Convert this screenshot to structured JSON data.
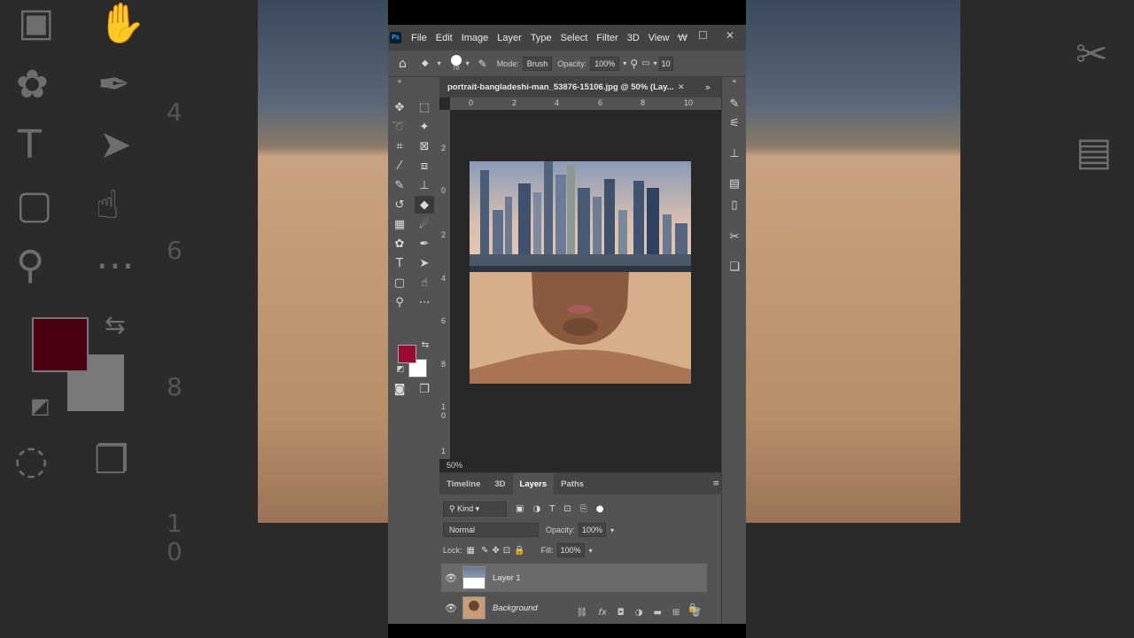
{
  "menu": {
    "items": [
      "File",
      "Edit",
      "Image",
      "Layer",
      "Type",
      "Select",
      "Filter",
      "3D",
      "View",
      "W"
    ]
  },
  "options": {
    "brush_size": "70",
    "mode_label": "Mode:",
    "mode_value": "Brush",
    "opacity_label": "Opacity:",
    "opacity_value": "100%",
    "extra_value": "10"
  },
  "document": {
    "tab_title": "portrait-bangladeshi-man_53876-15106.jpg @ 50% (Lay...",
    "zoom": "50%",
    "ruler_h": [
      "0",
      "2",
      "4",
      "6",
      "8",
      "10"
    ],
    "ruler_v": [
      "2",
      "0",
      "2",
      "4",
      "6",
      "8",
      "1",
      "0",
      "1"
    ]
  },
  "colors": {
    "foreground": "#9b0a32",
    "background": "#ffffff"
  },
  "panel": {
    "tabs": [
      "Timeline",
      "3D",
      "Layers",
      "Paths"
    ],
    "active_tab": "Layers",
    "filter_kind": "Kind",
    "blend_mode": "Normal",
    "opacity_label": "Opacity:",
    "opacity_value": "100%",
    "lock_label": "Lock:",
    "fill_label": "Fill:",
    "fill_value": "100%",
    "layers": [
      {
        "name": "Layer 1",
        "selected": true,
        "visible": true,
        "locked": false
      },
      {
        "name": "Background",
        "selected": false,
        "visible": true,
        "locked": true
      }
    ]
  }
}
